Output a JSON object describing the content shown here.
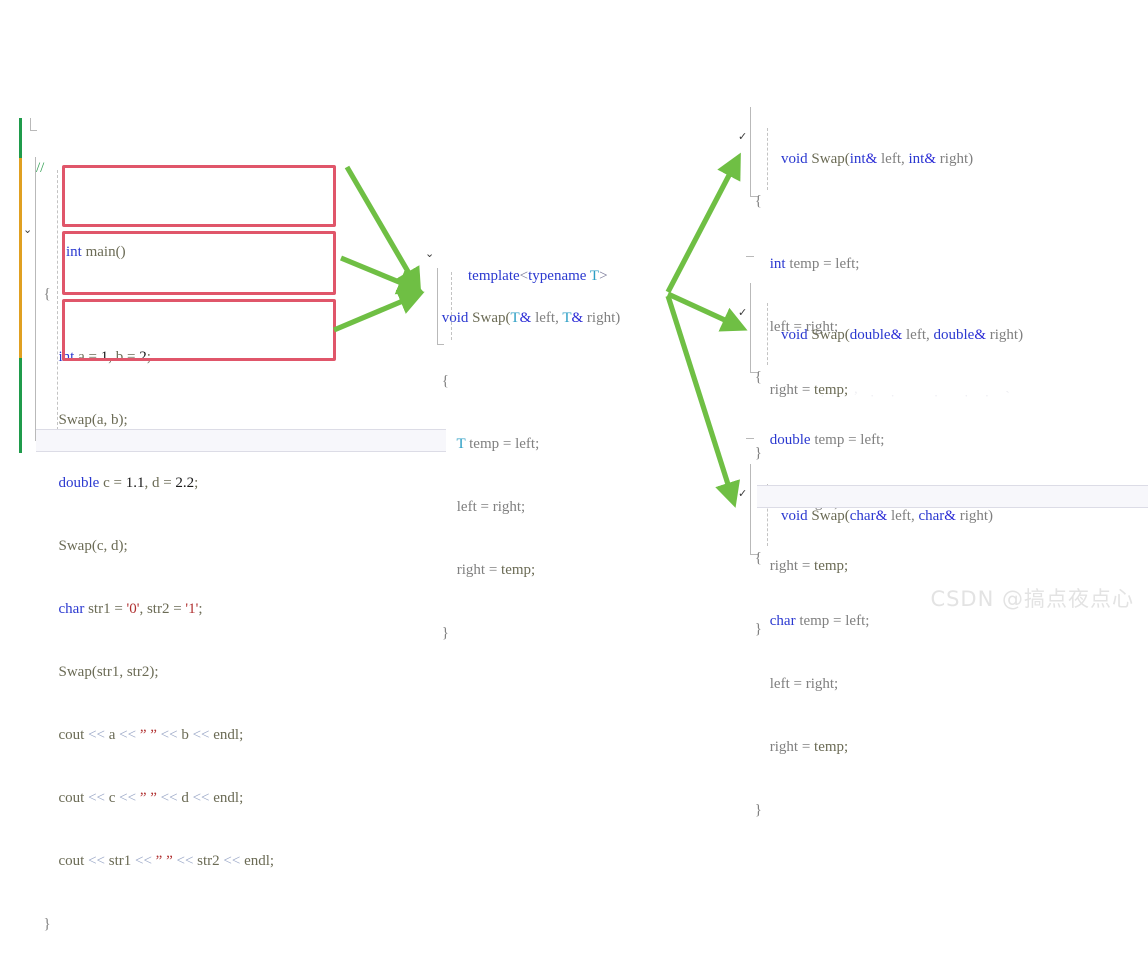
{
  "watermark": "CSDN @搞点夜点心",
  "colors": {
    "arrow_green": "#6fbf44",
    "redbox_border": "#e0566a",
    "keyword_blue": "#2b39d0",
    "type_cyan": "#2b9ec4",
    "string_red": "#b03030",
    "comment_green": "#2e9e4f",
    "changebar_green": "#1f9b4b",
    "changebar_orange": "#e0a021"
  },
  "main_block": {
    "name": "main-function",
    "fold_glyph": "⌄",
    "lines": [
      {
        "id": "comment",
        "text": "//"
      },
      {
        "id": "signature",
        "text": "int main()"
      },
      {
        "id": "open_brace",
        "text": "{"
      },
      {
        "id": "int_decl",
        "text": "int a = 1, b = 2;"
      },
      {
        "id": "swap_int",
        "text": "Swap(a, b);"
      },
      {
        "id": "double_decl",
        "text": "double c = 1.1, d = 2.2;"
      },
      {
        "id": "swap_double",
        "text": "Swap(c, d);"
      },
      {
        "id": "char_decl",
        "text": "char str1 = '0', str2 = '1';"
      },
      {
        "id": "swap_char",
        "text": "Swap(str1, str2);"
      },
      {
        "id": "cout_ab",
        "text": "cout << a << \" \" << b << endl;"
      },
      {
        "id": "cout_cd",
        "text": "cout << c << \" \" << d << endl;"
      },
      {
        "id": "cout_str",
        "text": "cout << str1 << \" \" << str2 << endl;"
      },
      {
        "id": "close_brace",
        "text": "}"
      }
    ]
  },
  "template_block": {
    "name": "swap-function-template",
    "fold_glyph": "⌄",
    "lines": [
      {
        "id": "template_head",
        "text": "template<typename T>"
      },
      {
        "id": "signature",
        "text": "void Swap(T& left, T& right)"
      },
      {
        "id": "open_brace",
        "text": "{"
      },
      {
        "id": "temp_decl",
        "text": "T temp = left;"
      },
      {
        "id": "left_assign",
        "text": "left = right;"
      },
      {
        "id": "right_assign",
        "text": "right = temp;"
      },
      {
        "id": "close_brace",
        "text": "}"
      }
    ]
  },
  "instantiations": [
    {
      "name": "swap-int-instantiation",
      "fold_glyph": "✓",
      "lines": [
        {
          "id": "signature",
          "text": "void Swap(int& left, int& right)"
        },
        {
          "id": "open_brace",
          "text": "{"
        },
        {
          "id": "temp_decl",
          "text": "int temp = left;"
        },
        {
          "id": "left_assign",
          "text": "left = right;"
        },
        {
          "id": "right_assign",
          "text": "right = temp;"
        },
        {
          "id": "close_brace",
          "text": "}"
        }
      ]
    },
    {
      "name": "swap-double-instantiation",
      "fold_glyph": "✓",
      "lines": [
        {
          "id": "signature",
          "text": "void Swap(double& left, double& right)"
        },
        {
          "id": "open_brace",
          "text": "{"
        },
        {
          "id": "temp_decl",
          "text": "double temp = left;"
        },
        {
          "id": "left_assign",
          "text": "left = right;"
        },
        {
          "id": "right_assign",
          "text": "right = temp;"
        },
        {
          "id": "close_brace",
          "text": "}"
        }
      ]
    },
    {
      "name": "swap-char-instantiation",
      "fold_glyph": "✓",
      "lines": [
        {
          "id": "signature",
          "text": "void Swap(char& left, char& right)"
        },
        {
          "id": "open_brace",
          "text": "{"
        },
        {
          "id": "temp_decl",
          "text": "char temp = left;"
        },
        {
          "id": "left_assign",
          "text": "left = right;"
        },
        {
          "id": "right_assign",
          "text": "right = temp;"
        },
        {
          "id": "close_brace",
          "text": "}"
        }
      ]
    }
  ],
  "arrows": {
    "to_template": [
      {
        "id": "int-call-to-template"
      },
      {
        "id": "double-call-to-template"
      },
      {
        "id": "char-call-to-template"
      }
    ],
    "from_template": [
      {
        "id": "template-to-int-instantiation"
      },
      {
        "id": "template-to-double-instantiation"
      },
      {
        "id": "template-to-char-instantiation"
      }
    ]
  }
}
